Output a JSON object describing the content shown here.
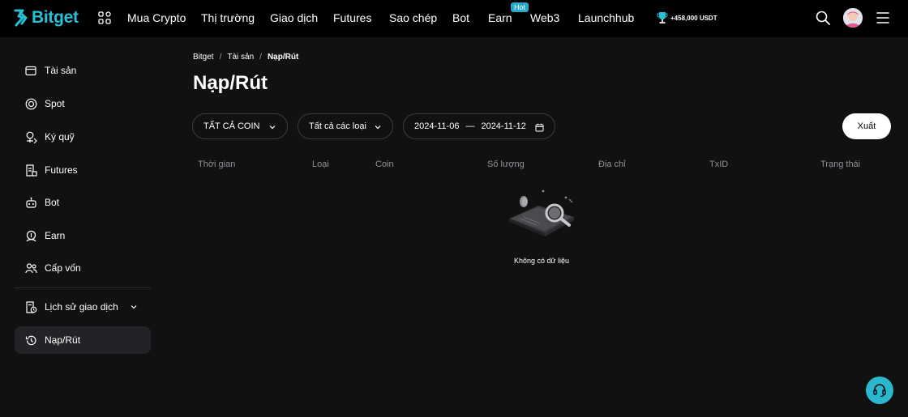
{
  "brand": {
    "name": "Bitget",
    "accent": "#27c0d6"
  },
  "nav": {
    "items": [
      "Mua Crypto",
      "Thị trường",
      "Giao dịch",
      "Futures",
      "Sao chép",
      "Bot",
      "Earn",
      "Web3",
      "Launchhub"
    ],
    "hot_badge": "Hot",
    "promo": "+458,000 USDT"
  },
  "sidebar": {
    "items": [
      {
        "label": "Tài sản",
        "icon": "wallet-icon"
      },
      {
        "label": "Spot",
        "icon": "spot-icon"
      },
      {
        "label": "Ký quỹ",
        "icon": "margin-icon"
      },
      {
        "label": "Futures",
        "icon": "futures-icon"
      },
      {
        "label": "Bot",
        "icon": "bot-icon"
      },
      {
        "label": "Earn",
        "icon": "earn-icon"
      },
      {
        "label": "Cấp vốn",
        "icon": "funding-icon"
      },
      {
        "label": "Lịch sử giao dịch",
        "icon": "history-doc-icon"
      },
      {
        "label": "Nạp/Rút",
        "icon": "history-clock-icon"
      }
    ],
    "active": "Nạp/Rút"
  },
  "breadcrumb": {
    "items": [
      "Bitget",
      "Tài sản",
      "Nạp/Rút"
    ],
    "separator": "/"
  },
  "page": {
    "title": "Nạp/Rút"
  },
  "filters": {
    "coin": "TẤT CẢ COIN",
    "type": "Tất cả các loại",
    "date_from": "2024-11-06",
    "date_sep": "—",
    "date_to": "2024-11-12"
  },
  "export_label": "Xuất",
  "table": {
    "columns": [
      "Thời gian",
      "Loại",
      "Coin",
      "Số lượng",
      "Địa chỉ",
      "TxID",
      "Trạng thái"
    ]
  },
  "empty": {
    "message": "Không có dữ liệu"
  }
}
